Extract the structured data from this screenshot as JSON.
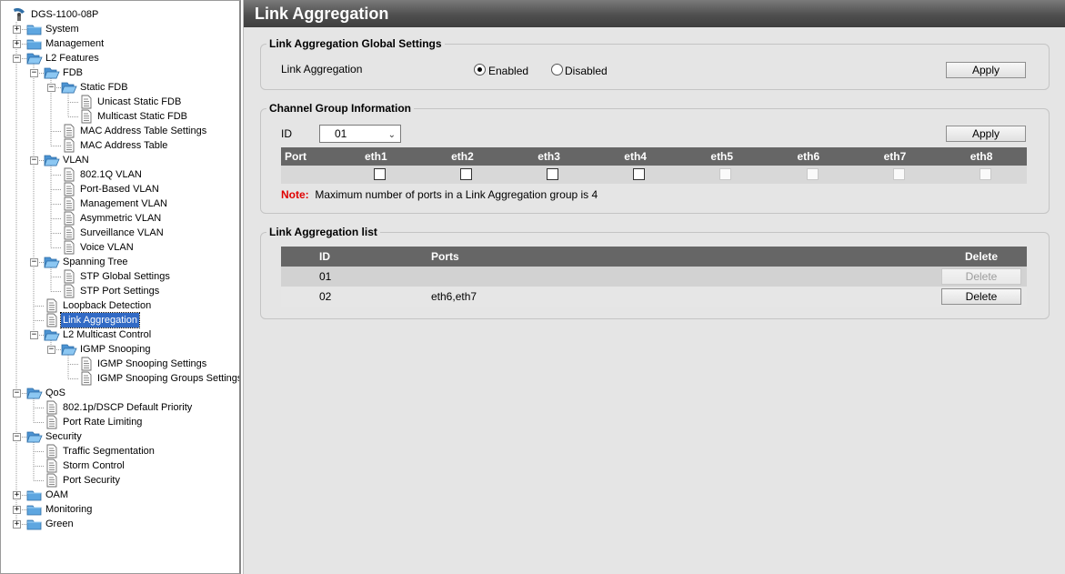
{
  "tree": {
    "root": "DGS-1100-08P",
    "system": "System",
    "management": "Management",
    "l2": "L2 Features",
    "fdb": "FDB",
    "static_fdb": "Static FDB",
    "unicast_static_fdb": "Unicast Static FDB",
    "multicast_static_fdb": "Multicast Static FDB",
    "mac_table_settings": "MAC Address Table Settings",
    "mac_table": "MAC Address Table",
    "vlan": "VLAN",
    "vlan_8021q": "802.1Q VLAN",
    "port_based_vlan": "Port-Based VLAN",
    "management_vlan": "Management VLAN",
    "asymmetric_vlan": "Asymmetric VLAN",
    "surveillance_vlan": "Surveillance VLAN",
    "voice_vlan": "Voice VLAN",
    "spanning_tree": "Spanning Tree",
    "stp_global": "STP Global Settings",
    "stp_port": "STP Port Settings",
    "loopback": "Loopback Detection",
    "link_aggregation": "Link Aggregation",
    "l2_multicast": "L2 Multicast Control",
    "igmp_snooping": "IGMP Snooping",
    "igmp_settings": "IGMP Snooping Settings",
    "igmp_groups": "IGMP Snooping Groups Settings",
    "qos": "QoS",
    "dscp": "802.1p/DSCP Default Priority",
    "port_rate": "Port Rate Limiting",
    "security": "Security",
    "traffic_seg": "Traffic Segmentation",
    "storm": "Storm Control",
    "port_security": "Port Security",
    "oam": "OAM",
    "monitoring": "Monitoring",
    "green": "Green"
  },
  "page": {
    "title": "Link Aggregation"
  },
  "global_settings": {
    "legend": "Link Aggregation Global Settings",
    "label": "Link Aggregation",
    "enabled_label": "Enabled",
    "disabled_label": "Disabled",
    "selected": "Enabled",
    "apply_label": "Apply"
  },
  "channel_group": {
    "legend": "Channel Group Information",
    "id_label": "ID",
    "id_value": "01",
    "apply_label": "Apply",
    "port_header": "Port",
    "ports": [
      "eth1",
      "eth2",
      "eth3",
      "eth4",
      "eth5",
      "eth6",
      "eth7",
      "eth8"
    ],
    "port_enabled": [
      true,
      true,
      true,
      true,
      false,
      false,
      false,
      false
    ],
    "port_checked": [
      false,
      false,
      false,
      false,
      false,
      false,
      false,
      false
    ],
    "note_label": "Note:",
    "note_text": "Maximum number of ports in a Link Aggregation group is 4"
  },
  "agg_list": {
    "legend": "Link Aggregation list",
    "headers": {
      "id": "ID",
      "ports": "Ports",
      "delete": "Delete"
    },
    "rows": [
      {
        "id": "01",
        "ports": "",
        "delete_label": "Delete",
        "delete_enabled": false
      },
      {
        "id": "02",
        "ports": "eth6,eth7",
        "delete_label": "Delete",
        "delete_enabled": true
      }
    ]
  }
}
